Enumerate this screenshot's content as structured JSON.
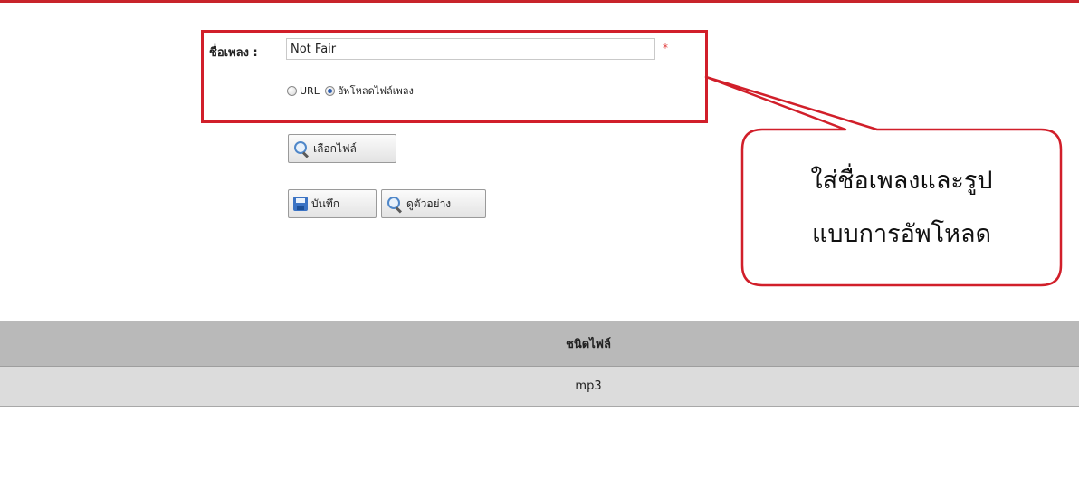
{
  "form": {
    "song_label": "ชื่อเพลง :",
    "song_value": "Not Fair",
    "required_mark": "*",
    "radio_url_label": "URL",
    "radio_upload_label": "อัพโหลดไฟล์เพลง",
    "selected_source": "upload",
    "choose_file_label": "เลือกไฟล์",
    "save_label": "บันทึก",
    "preview_label": "ดูตัวอย่าง"
  },
  "callout": {
    "line1": "ใส่ชื่อเพลงและรูป",
    "line2": "แบบการอัพโหลด"
  },
  "table": {
    "header": "ชนิดไฟล์",
    "rows": [
      "mp3"
    ]
  },
  "colors": {
    "accent_red": "#d11f2a",
    "table_header": "#b9b9b9",
    "table_row": "#dcdcdc"
  },
  "icons": {
    "choose_file": "magnifier-icon",
    "save": "floppy-disk-icon",
    "preview": "magnifier-icon"
  }
}
